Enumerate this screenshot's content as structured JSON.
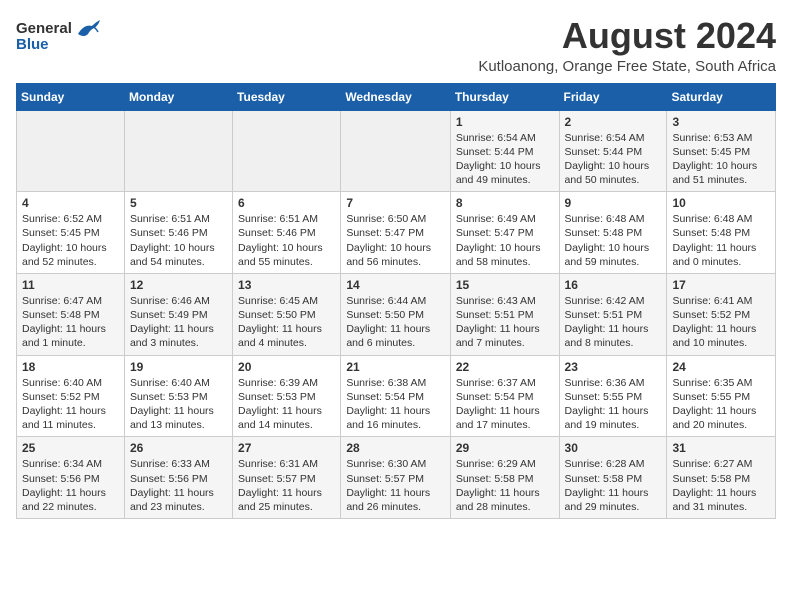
{
  "header": {
    "logo_general": "General",
    "logo_blue": "Blue",
    "title": "August 2024",
    "subtitle": "Kutloanong, Orange Free State, South Africa"
  },
  "weekdays": [
    "Sunday",
    "Monday",
    "Tuesday",
    "Wednesday",
    "Thursday",
    "Friday",
    "Saturday"
  ],
  "weeks": [
    [
      {
        "day": "",
        "info": ""
      },
      {
        "day": "",
        "info": ""
      },
      {
        "day": "",
        "info": ""
      },
      {
        "day": "",
        "info": ""
      },
      {
        "day": "1",
        "info": "Sunrise: 6:54 AM\nSunset: 5:44 PM\nDaylight: 10 hours\nand 49 minutes."
      },
      {
        "day": "2",
        "info": "Sunrise: 6:54 AM\nSunset: 5:44 PM\nDaylight: 10 hours\nand 50 minutes."
      },
      {
        "day": "3",
        "info": "Sunrise: 6:53 AM\nSunset: 5:45 PM\nDaylight: 10 hours\nand 51 minutes."
      }
    ],
    [
      {
        "day": "4",
        "info": "Sunrise: 6:52 AM\nSunset: 5:45 PM\nDaylight: 10 hours\nand 52 minutes."
      },
      {
        "day": "5",
        "info": "Sunrise: 6:51 AM\nSunset: 5:46 PM\nDaylight: 10 hours\nand 54 minutes."
      },
      {
        "day": "6",
        "info": "Sunrise: 6:51 AM\nSunset: 5:46 PM\nDaylight: 10 hours\nand 55 minutes."
      },
      {
        "day": "7",
        "info": "Sunrise: 6:50 AM\nSunset: 5:47 PM\nDaylight: 10 hours\nand 56 minutes."
      },
      {
        "day": "8",
        "info": "Sunrise: 6:49 AM\nSunset: 5:47 PM\nDaylight: 10 hours\nand 58 minutes."
      },
      {
        "day": "9",
        "info": "Sunrise: 6:48 AM\nSunset: 5:48 PM\nDaylight: 10 hours\nand 59 minutes."
      },
      {
        "day": "10",
        "info": "Sunrise: 6:48 AM\nSunset: 5:48 PM\nDaylight: 11 hours\nand 0 minutes."
      }
    ],
    [
      {
        "day": "11",
        "info": "Sunrise: 6:47 AM\nSunset: 5:48 PM\nDaylight: 11 hours\nand 1 minute."
      },
      {
        "day": "12",
        "info": "Sunrise: 6:46 AM\nSunset: 5:49 PM\nDaylight: 11 hours\nand 3 minutes."
      },
      {
        "day": "13",
        "info": "Sunrise: 6:45 AM\nSunset: 5:50 PM\nDaylight: 11 hours\nand 4 minutes."
      },
      {
        "day": "14",
        "info": "Sunrise: 6:44 AM\nSunset: 5:50 PM\nDaylight: 11 hours\nand 6 minutes."
      },
      {
        "day": "15",
        "info": "Sunrise: 6:43 AM\nSunset: 5:51 PM\nDaylight: 11 hours\nand 7 minutes."
      },
      {
        "day": "16",
        "info": "Sunrise: 6:42 AM\nSunset: 5:51 PM\nDaylight: 11 hours\nand 8 minutes."
      },
      {
        "day": "17",
        "info": "Sunrise: 6:41 AM\nSunset: 5:52 PM\nDaylight: 11 hours\nand 10 minutes."
      }
    ],
    [
      {
        "day": "18",
        "info": "Sunrise: 6:40 AM\nSunset: 5:52 PM\nDaylight: 11 hours\nand 11 minutes."
      },
      {
        "day": "19",
        "info": "Sunrise: 6:40 AM\nSunset: 5:53 PM\nDaylight: 11 hours\nand 13 minutes."
      },
      {
        "day": "20",
        "info": "Sunrise: 6:39 AM\nSunset: 5:53 PM\nDaylight: 11 hours\nand 14 minutes."
      },
      {
        "day": "21",
        "info": "Sunrise: 6:38 AM\nSunset: 5:54 PM\nDaylight: 11 hours\nand 16 minutes."
      },
      {
        "day": "22",
        "info": "Sunrise: 6:37 AM\nSunset: 5:54 PM\nDaylight: 11 hours\nand 17 minutes."
      },
      {
        "day": "23",
        "info": "Sunrise: 6:36 AM\nSunset: 5:55 PM\nDaylight: 11 hours\nand 19 minutes."
      },
      {
        "day": "24",
        "info": "Sunrise: 6:35 AM\nSunset: 5:55 PM\nDaylight: 11 hours\nand 20 minutes."
      }
    ],
    [
      {
        "day": "25",
        "info": "Sunrise: 6:34 AM\nSunset: 5:56 PM\nDaylight: 11 hours\nand 22 minutes."
      },
      {
        "day": "26",
        "info": "Sunrise: 6:33 AM\nSunset: 5:56 PM\nDaylight: 11 hours\nand 23 minutes."
      },
      {
        "day": "27",
        "info": "Sunrise: 6:31 AM\nSunset: 5:57 PM\nDaylight: 11 hours\nand 25 minutes."
      },
      {
        "day": "28",
        "info": "Sunrise: 6:30 AM\nSunset: 5:57 PM\nDaylight: 11 hours\nand 26 minutes."
      },
      {
        "day": "29",
        "info": "Sunrise: 6:29 AM\nSunset: 5:58 PM\nDaylight: 11 hours\nand 28 minutes."
      },
      {
        "day": "30",
        "info": "Sunrise: 6:28 AM\nSunset: 5:58 PM\nDaylight: 11 hours\nand 29 minutes."
      },
      {
        "day": "31",
        "info": "Sunrise: 6:27 AM\nSunset: 5:58 PM\nDaylight: 11 hours\nand 31 minutes."
      }
    ]
  ]
}
